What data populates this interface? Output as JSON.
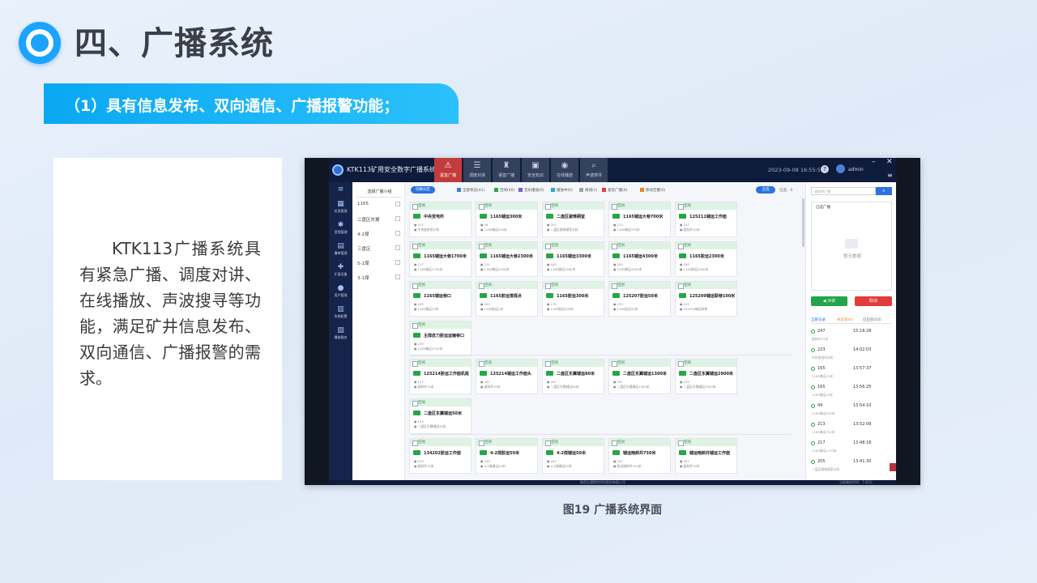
{
  "slide": {
    "title": "四、广播系统",
    "subtitle": "（1）具有信息发布、双向通信、广播报警功能；",
    "body": "KTK113广播系统具有紧急广播、调度对讲、在线播放、声波搜寻等功能，满足矿井信息发布、双向通信、广播报警的需求。",
    "caption": "图19 广播系统界面"
  },
  "app": {
    "title": "KTK113矿用安全数字广播系统",
    "datetime": "2023-09-08 16:55:56",
    "user": "admin",
    "top_buttons": [
      {
        "label": "紧急广播",
        "icon": "alarm-icon",
        "active": true
      },
      {
        "label": "调度对讲",
        "icon": "intercom-icon"
      },
      {
        "label": "语音广播",
        "icon": "broadcast-icon"
      },
      {
        "label": "安全知识",
        "icon": "book-icon"
      },
      {
        "label": "在线播放",
        "icon": "play-icon"
      },
      {
        "label": "声波搜寻",
        "icon": "search-wave-icon"
      }
    ],
    "nav": [
      {
        "label": "应用管理",
        "icon": "apps-icon"
      },
      {
        "label": "音频管理",
        "icon": "audio-icon"
      },
      {
        "label": "播单管理",
        "icon": "list-icon"
      },
      {
        "label": "扩展设备",
        "icon": "device-icon"
      },
      {
        "label": "用户管理",
        "icon": "user-icon"
      },
      {
        "label": "系统配置",
        "icon": "settings-icon"
      },
      {
        "label": "播放服务",
        "icon": "server-icon"
      }
    ],
    "group_panel": {
      "header": "选择广播小组",
      "groups": [
        "1165",
        "二盘区东翼",
        "4-2煤",
        "三盘区",
        "5-1煤",
        "3-1煤"
      ]
    },
    "filter": {
      "button": "切换分区",
      "legend": [
        {
          "label": "全部状态(41)",
          "color": "#3b7de0"
        },
        {
          "label": "空闲(40)",
          "color": "#27a548"
        },
        {
          "label": "音乐播放(0)",
          "color": "#7b5fd0"
        },
        {
          "label": "播放中(0)",
          "color": "#2aa6d8"
        },
        {
          "label": "离线(1)",
          "color": "#9aa3ae"
        },
        {
          "label": "紧急广播(0)",
          "color": "#e03c3c"
        },
        {
          "label": "移动告警(0)",
          "color": "#e0872c"
        }
      ],
      "ok_button": "全选",
      "selected": "已选：0"
    },
    "cards": [
      {
        "status": "空闲",
        "name": "中央变电所",
        "l1": "● 222",
        "l2": "● 中央变电所分机"
      },
      {
        "status": "空闲",
        "name": "1165辅运300米",
        "l1": "● 46",
        "l2": "● 1165辅运300米"
      },
      {
        "status": "空闲",
        "name": "二盘区避难硐室",
        "l1": "● 203",
        "l2": "● 二盘区避难硐室分机"
      },
      {
        "status": "空闲",
        "name": "1165辅运大巷700米",
        "l1": "● 213",
        "l2": "● 1165辅运700米"
      },
      {
        "status": "空闲",
        "name": "125211辅运工作面",
        "l1": "● 247",
        "l2": "● 副斜井10米"
      },
      {
        "status": "空闲",
        "name": "1165辅运大巷1700米",
        "l1": "● 217",
        "l2": "● 1165辅运1700米"
      },
      {
        "status": "空闲",
        "name": "1165辅运大巷2300米",
        "l1": "● 215",
        "l2": "● 1165辅运2300米"
      },
      {
        "status": "空闲",
        "name": "1165辅运3300米",
        "l1": "● 183",
        "l2": "● 1165辅运3300米"
      },
      {
        "status": "空闲",
        "name": "1165辅运4300米",
        "l1": "● 183",
        "l2": "● 1165辅运4300米"
      },
      {
        "status": "空闲",
        "name": "1165胶运2300米",
        "l1": "● 189",
        "l2": "● 1165胶运2300米"
      },
      {
        "status": "空闲",
        "name": "1165辅运巷口",
        "l1": "● 165",
        "l2": "● 1165辅运10米"
      },
      {
        "status": "空闲",
        "name": "1165胶运落煤点",
        "l1": "● 169",
        "l2": "● 1165胶运1米"
      },
      {
        "status": "空闲",
        "name": "1165胶运300米",
        "l1": "● 178",
        "l2": "● 1165胶运300米"
      },
      {
        "status": "空闲",
        "name": "125207胶运50米",
        "l1": "● 233",
        "l2": "● 1165胶运50米"
      },
      {
        "status": "空闲",
        "name": "125209辅运联巷100米",
        "l1": "● 241",
        "l2": "● 125209辅运联巷"
      },
      {
        "status": "空闲",
        "name": "主煤皮力胶运运输巷口",
        "l1": "● 239",
        "l2": "● 1165辅运4710米"
      },
      {
        "status": "空闲",
        "name": "125214胶运工作面机尾",
        "l1": "● 227",
        "l2": "● 副斜井10米"
      },
      {
        "status": "空闲",
        "name": "125214辅运工作面头",
        "l1": "● 167",
        "l2": "● 副斜井10米"
      },
      {
        "status": "空闲",
        "name": "二盘区东翼辅运80米",
        "l1": "● 187",
        "l2": "● 二盘区东翼辅运80米"
      },
      {
        "status": "空闲",
        "name": "二盘区东翼辅运1300米",
        "l1": "● 187",
        "l2": "● 二盘区东翼辅运1300米"
      },
      {
        "status": "空闲",
        "name": "二盘区东翼辅运2900米",
        "l1": "● 199",
        "l2": "● 二盘区东翼辅运2900米"
      },
      {
        "status": "空闲",
        "name": "二盘区东翼辅运50米",
        "l1": "● 193",
        "l2": "● 二盘区东翼辅运50米"
      },
      {
        "status": "空闲",
        "name": "134202胶运工作面",
        "l1": "● 243",
        "l2": "● 副斜井10米"
      },
      {
        "status": "空闲",
        "name": "4-2煤胶运50米",
        "l1": "● 249",
        "l2": "● 4-2煤辅运50米"
      },
      {
        "status": "空闲",
        "name": "4-2煤辅运50米",
        "l1": "● 187",
        "l2": "● 4-2煤辅运50米"
      },
      {
        "status": "空闲",
        "name": "辅运暗斜井750米",
        "l1": "● 187",
        "l2": "● 胶运暗斜井750米"
      },
      {
        "status": "空闲",
        "name": "辅运暗斜井辅运工作面",
        "l1": "● 201",
        "l2": "● 副斜井10米"
      }
    ],
    "right": {
      "search_placeholder": "请选择广播",
      "search_icon": "search-icon",
      "selected_title": "已选广播",
      "empty_text": "暂无数据",
      "talk_button": "对讲",
      "cancel_button": "取消",
      "tabs": [
        "全部记录",
        "未应答(0)",
        "已应答(10)"
      ],
      "records": [
        {
          "num": "247",
          "time": "15:18:28",
          "desc": "副斜井10米"
        },
        {
          "num": "223",
          "time": "14:02:03",
          "desc": "中央变电所分机"
        },
        {
          "num": "165",
          "time": "13:57:37",
          "desc": "1165辅运10米"
        },
        {
          "num": "165",
          "time": "13:56:25",
          "desc": "1165辅运10米"
        },
        {
          "num": "49",
          "time": "13:54:10",
          "desc": "1165辅运300米"
        },
        {
          "num": "213",
          "time": "13:52:09",
          "desc": "1165辅运700米"
        },
        {
          "num": "217",
          "time": "13:48:18",
          "desc": "1165辅运1700米"
        },
        {
          "num": "205",
          "time": "13:41:30",
          "desc": "二盘区避难硐室分机"
        }
      ]
    },
    "footer": {
      "center": "陕西太通智控科技股份有限公司",
      "right": "当前服务时间：7.02天"
    }
  }
}
